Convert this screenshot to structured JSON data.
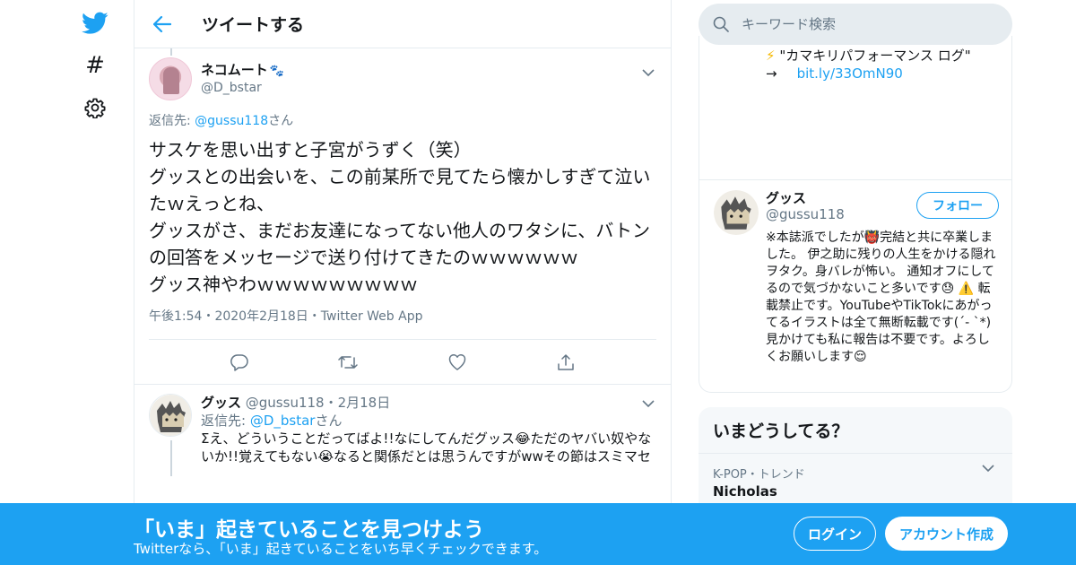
{
  "nav": {
    "icons": [
      "twitter-bird-icon",
      "hashtag-icon",
      "gear-icon"
    ],
    "hashtag_glyph": "#"
  },
  "header": {
    "title": "ツイートする"
  },
  "tweet": {
    "author_name": "ネコムート",
    "author_handle": "@D_bstar",
    "reply_prefix": "返信先: ",
    "reply_handle": "@gussu118",
    "reply_suffix": "さん",
    "text": "サスケを思い出すと子宮がうずく（笑）\nグッスとの出会いを、この前某所で見てたら懐かしすぎて泣いたｗえっとね、\nグッスがさ、まだお友達になってない他人のワタシに、バトンの回答をメッセージで送り付けてきたのｗｗｗｗｗｗ\nグッス神やわｗｗｗｗｗｗｗｗｗ",
    "meta": "午後1:54・2020年2月18日・Twitter Web App"
  },
  "reply": {
    "name": "グッス",
    "handle_date": " @gussu118・2月18日",
    "reply_prefix": "返信先: ",
    "reply_handle": "@D_bstar",
    "reply_suffix": "さん",
    "text": "Σえ、どういうことだってばよ!!なにしてんだグッス😂ただのヤバい奴やないか!!覚えてもない😭なると関係だとは思うんですがwwその節はスミマセ"
  },
  "search": {
    "placeholder": "キーワード検索"
  },
  "profile": {
    "pinned_line1": "\"カマキリパフォーマンス ログ\"",
    "pinned_arrow": "→",
    "pinned_link": "bit.ly/33OmN90",
    "name": "グッス",
    "handle": "@gussu118",
    "follow_label": "フォロー",
    "bio": "※本誌派でしたが👹完結と共に卒業しました。 伊之助に残りの人生をかける隠れヲタク。身バレが怖い。 通知オフにしてるので気づかないこと多いです😓 ⚠️ 転載禁止です。YouTubeやTikTokにあがってるイラストは全て無断転載です(´- `*)見かけても私に報告は不要です。よろしくお願いします😌"
  },
  "trends": {
    "title": "いまどうしてる？",
    "items": [
      {
        "meta": "K-POP・トレンド",
        "name": "Nicholas"
      }
    ]
  },
  "banner": {
    "title": "「いま」起きていることを見つけよう",
    "subtitle": "Twitterなら、「いま」起きていることをいち早くチェックできます。",
    "login_label": "ログイン",
    "signup_label": "アカウント作成"
  },
  "colors": {
    "accent": "#1da1f2",
    "text": "#14171a",
    "muted": "#657786",
    "border": "#e6ecf0"
  }
}
